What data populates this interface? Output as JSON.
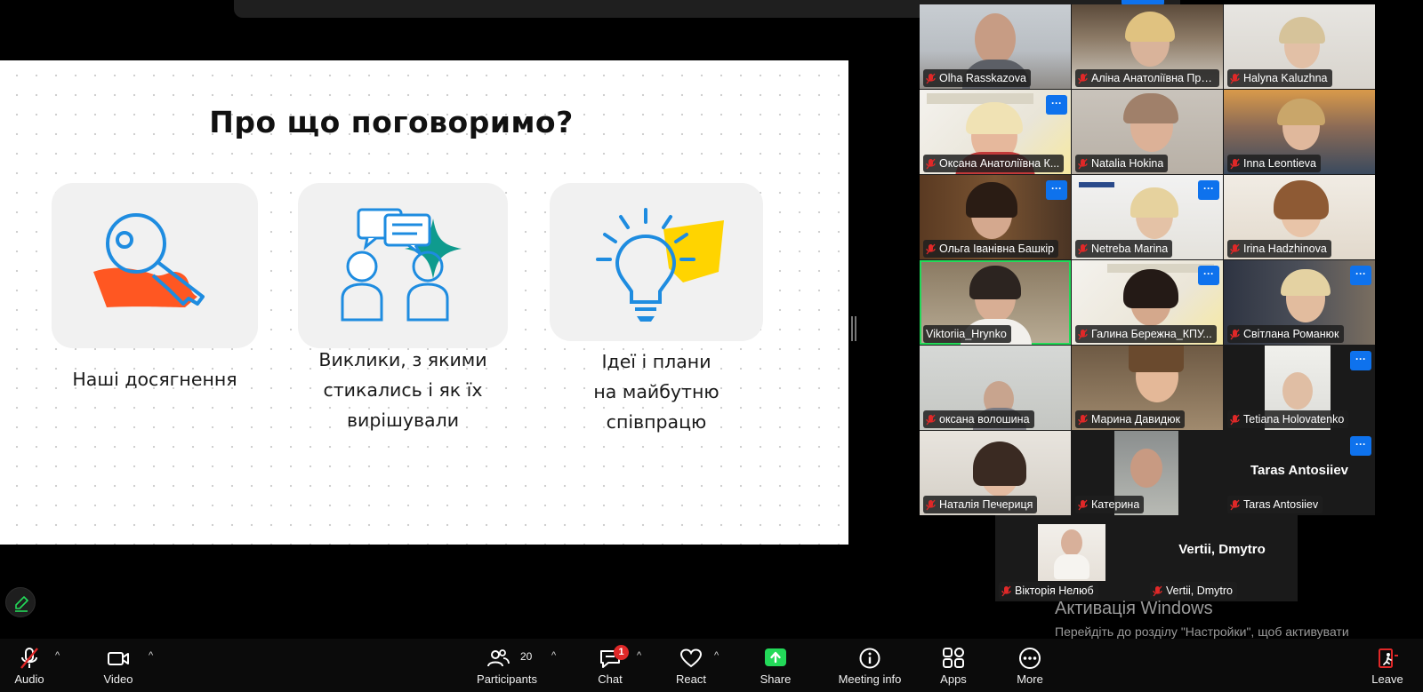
{
  "slide": {
    "title": "Про що поговоримо?",
    "cards": [
      {
        "lines": [
          "Наші досягнення"
        ],
        "icon": "key-hand-icon"
      },
      {
        "lines": [
          "Виклики, з якими",
          "стикались і як їх",
          "вирішували"
        ],
        "icon": "people-chat-icon"
      },
      {
        "lines": [
          "Ідеї і плани",
          "на майбутню",
          "співпрацю"
        ],
        "icon": "lightbulb-icon"
      }
    ],
    "colors": {
      "blue": "#1e8ce0",
      "orange": "#ff5722",
      "teal": "#0f9b8e",
      "yellow": "#ffd400"
    }
  },
  "gallery": {
    "rows": [
      [
        "Olha Rasskazova",
        "Аліна Анатоліївна Пре...",
        "Halyna Kaluzhna"
      ],
      [
        "Оксана Анатоліївна К...",
        "Natalia Hokina",
        "Inna Leontieva"
      ],
      [
        "Ольга Іванівна Башкір",
        "Netreba Marina",
        "Irina Hadzhinova"
      ],
      [
        "Viktoriia_Hrynko",
        "Галина Бережна_КПУ...",
        "Світлана Романюк"
      ],
      [
        "оксана волошина",
        "Марина Давидюк",
        "Tetiana Holovatenko"
      ],
      [
        "Наталія Печериця",
        "Катерина",
        "Taras Antosiiev"
      ]
    ],
    "taras_big_name": "Taras Antosiiev",
    "extra": [
      "Вікторія Нелюб",
      "Vertii, Dmytro"
    ],
    "vertii_big_name": "Vertii, Dmytro",
    "more_label": "···",
    "active_speaker_color": "#23d959"
  },
  "windows_activation": {
    "title": "Активація Windows",
    "text": "Перейдіть до розділу \"Настройки\", щоб активувати Windows."
  },
  "toolbar": {
    "audio": "Audio",
    "video": "Video",
    "participants": "Participants",
    "participant_count": "20",
    "chat": "Chat",
    "chat_badge": "1",
    "react": "React",
    "share": "Share",
    "meeting_info": "Meeting info",
    "apps": "Apps",
    "more": "More",
    "leave": "Leave",
    "caret": "^",
    "share_color": "#23d959",
    "leave_color": "#e02828"
  }
}
